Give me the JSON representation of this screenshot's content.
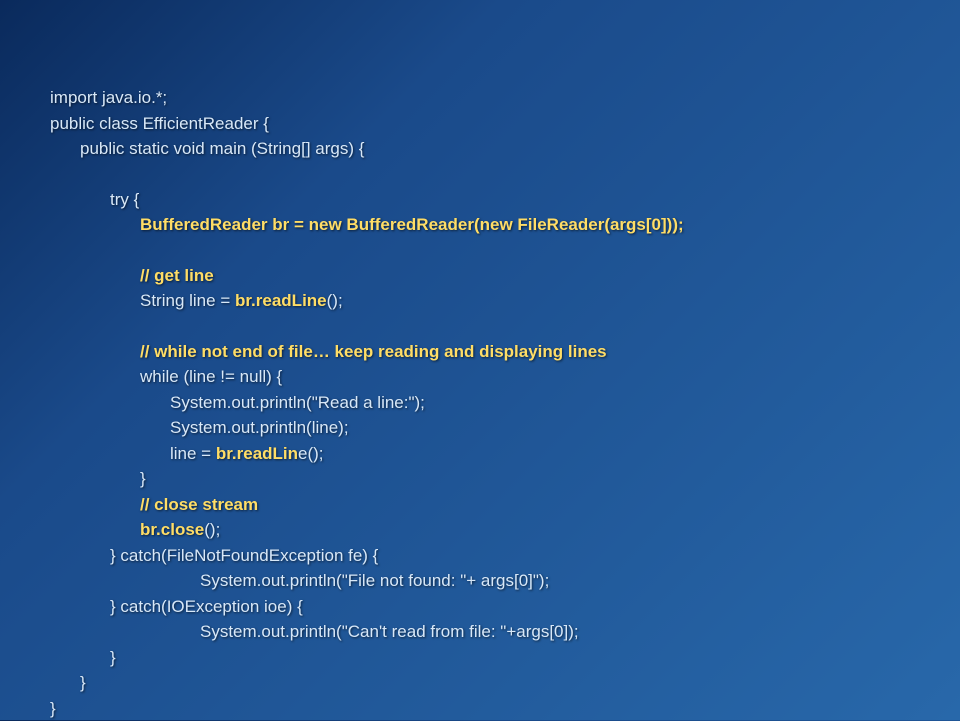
{
  "code": {
    "l1": "import java.io.*;",
    "l2": "public class EfficientReader {",
    "l3": "public static void main (String[] args) {",
    "l4": "try {",
    "l5a": "BufferedReader br = new BufferedReader(new FileReader(args[0]));",
    "l6": "// get line",
    "l7a": "String line = ",
    "l7b": "br.readLine",
    "l7c": "();",
    "l8": "// while not end of file… keep reading and displaying lines",
    "l9": "while (line != null) {",
    "l10": "System.out.println(\"Read a line:\");",
    "l11": "System.out.println(line);",
    "l12a": "line = ",
    "l12b": "br.readLin",
    "l12c": "e();",
    "l13": "}",
    "l14": "// close stream",
    "l15a": "br.close",
    "l15b": "();",
    "l16": "} catch(FileNotFoundException fe) {",
    "l17": "System.out.println(\"File not found: \"+ args[0]\");",
    "l18": "} catch(IOException ioe) {",
    "l19": "System.out.println(\"Can't read from file: \"+args[0]);",
    "l20": "}",
    "l21": "}",
    "l22": "}"
  }
}
